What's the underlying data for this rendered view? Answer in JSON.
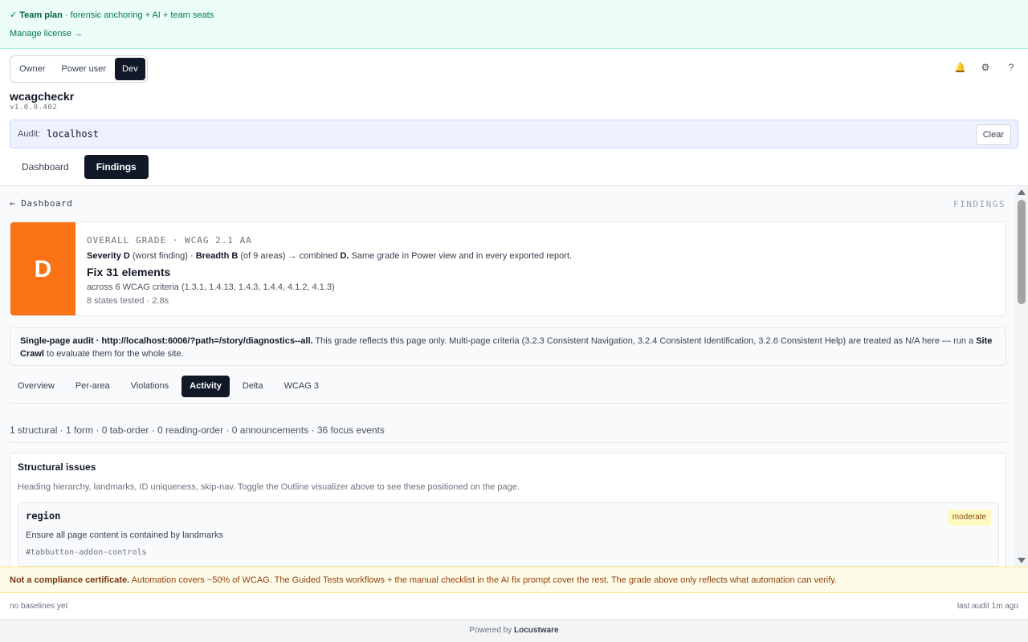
{
  "license": {
    "check": "✓",
    "plan": "Team plan",
    "plan_detail": " · forensic anchoring + AI + team seats",
    "manage_link": "Manage license →"
  },
  "roles": {
    "owner": "Owner",
    "power_user": "Power user",
    "dev": "Dev",
    "active": "Dev"
  },
  "header_icons": {
    "bell": "🔔",
    "gear": "⚙",
    "help": "?"
  },
  "app": {
    "name": "wcagcheckr",
    "version": "v1.0.0.402"
  },
  "audit": {
    "label": "Audit:",
    "value": "localhost",
    "clear_label": "Clear"
  },
  "main_tabs": {
    "dashboard": "Dashboard",
    "findings": "Findings",
    "active": "Findings"
  },
  "findings": {
    "back_link": "← Dashboard",
    "section_label": "FINDINGS",
    "grade": {
      "letter": "D",
      "color": "#f97316",
      "title": "OVERALL GRADE · WCAG 2.1 AA",
      "severity_label": "Severity D",
      "severity_note": " (worst finding) · ",
      "breadth_label": "Breadth B",
      "breadth_note": " (of 9 areas) → combined ",
      "combined": "D.",
      "tail": " Same grade in Power view and in every exported report.",
      "fix_headline": "Fix 31 elements",
      "criteria": "across 6 WCAG criteria (1.3.1, 1.4.13, 1.4.3, 1.4.4, 4.1.2, 4.1.3)",
      "states": "8 states tested · 2.8s"
    },
    "scope": {
      "label": "Single-page audit · http://localhost:6006/?path=/story/diagnostics--all.",
      "text": " This grade reflects this page only. Multi-page criteria (3.2.3 Consistent Navigation, 3.2.4 Consistent Identification, 3.2.6 Consistent Help) are treated as N/A here — run a ",
      "link": "Site Crawl",
      "text2": " to evaluate them for the whole site."
    },
    "sub_tabs": {
      "overview": "Overview",
      "per_area": "Per-area",
      "violations": "Violations",
      "activity": "Activity",
      "delta": "Delta",
      "wcag3": "WCAG 3",
      "active": "Activity"
    },
    "counts": "1 structural · 1 form · 0 tab-order · 0 reading-order · 0 announcements · 36 focus events",
    "structural": {
      "title": "Structural issues",
      "description": "Heading hierarchy, landmarks, ID uniqueness, skip-nav. Toggle the Outline visualizer above to see these positioned on the page.",
      "issues": [
        {
          "rule": "region",
          "severity": "moderate",
          "description": "Ensure all page content is contained by landmarks",
          "selector": "#tabbutton-addon-controls"
        }
      ]
    }
  },
  "disclaimer": {
    "strong": "Not a compliance certificate.",
    "text": " Automation covers ~50% of WCAG. The Guided Tests workflows + the manual checklist in the AI fix prompt cover the rest. The grade above only reflects what automation can verify."
  },
  "footer": {
    "baselines": "no baselines yet",
    "last_audit": "last audit 1m ago",
    "powered_prefix": "Powered by ",
    "powered_brand": "Locustware"
  }
}
